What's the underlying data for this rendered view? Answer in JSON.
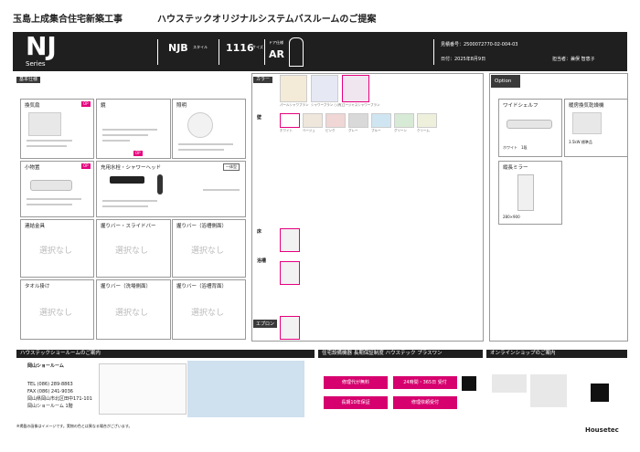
{
  "project_title": "玉島上成集合住宅新築工事",
  "proposal_title": "ハウステックオリジナルシステムバスルームのご提案",
  "header": {
    "model": "NJ",
    "series": "Series",
    "style_code": "NJB",
    "style_label": "スタイル",
    "size_code": "1116",
    "size_label": "サイズ",
    "door_code": "AR",
    "door_label": "ドア仕様",
    "quote_no": "見積番号：2500072770-02-004-03",
    "date": "日付：2025年8月9日",
    "staff": "担当者：兼俣 智恵子"
  },
  "labels": {
    "spec": "基本仕様",
    "color": "カラー",
    "option": "Option"
  },
  "spec_boxes": [
    {
      "title": "換気扇",
      "badge": "OP"
    },
    {
      "title": "鏡",
      "badge": "OP"
    },
    {
      "title": "照明"
    },
    {
      "title": "小物置",
      "badge": "OP"
    },
    {
      "title": "充用水栓・シャワーヘッド",
      "tag": "一体型"
    },
    {
      "title": "連結金具",
      "empty": "選択なし"
    },
    {
      "title": "握りバー・スライドバー",
      "empty": "選択なし"
    },
    {
      "title": "握りバー（浴槽側面）",
      "empty": "選択なし"
    },
    {
      "title": "タオル掛け",
      "empty": "選択なし"
    },
    {
      "title": "握りバー（洗場側面）",
      "empty": "選択なし"
    },
    {
      "title": "握りバー（浴槽背面）",
      "empty": "選択なし"
    }
  ],
  "color": {
    "bathtub_options": [
      "パールシャワブラン",
      "シャワーブラン ○(有)",
      "ゴージャスシャワーブラン"
    ],
    "wall_label": "壁",
    "wall_colors": [
      {
        "name": "ホワイト",
        "hex": "#ffffff"
      },
      {
        "name": "ベージュ",
        "hex": "#efe6dc"
      },
      {
        "name": "ピンク",
        "hex": "#f0d6d4"
      },
      {
        "name": "グレー",
        "hex": "#d9d9d9"
      },
      {
        "name": "ブルー",
        "hex": "#cfe6f2"
      },
      {
        "name": "グリーン",
        "hex": "#d7ead5"
      },
      {
        "name": "クリーム",
        "hex": "#eef0dc"
      }
    ],
    "floor_label": "床",
    "tub_label": "浴槽",
    "apron_label": "エプロン"
  },
  "option": {
    "items": [
      {
        "title": "ワイドシェルフ",
        "note": "ホワイト　1段"
      },
      {
        "title": "暖房換気乾燥機",
        "note": "3.5kW 標準品"
      },
      {
        "title": "縦長ミラー",
        "note": "280×900"
      }
    ]
  },
  "footer": {
    "showroom_title": "ハウステックショールームのご案内",
    "showroom_name": "岡山ショールーム",
    "showroom_lines": [
      "TEL (086) 289-8863",
      "FAX (086) 241-9036",
      "岡山県岡山市北区田中171-101",
      "岡山ショールーム 1階"
    ],
    "guarantee_title": "住宅設備機器 長期保証制度 ハウステック プラスワン",
    "guarantee_items": [
      "修理代が無料",
      "24時間・365日 受付",
      "長期10年保証",
      "修理依頼受付"
    ],
    "online_title": "オンラインショップのご案内",
    "brand": "Housetec",
    "note": "※掲載の画像はイメージです。実物の色とは異なる場合がございます。"
  }
}
